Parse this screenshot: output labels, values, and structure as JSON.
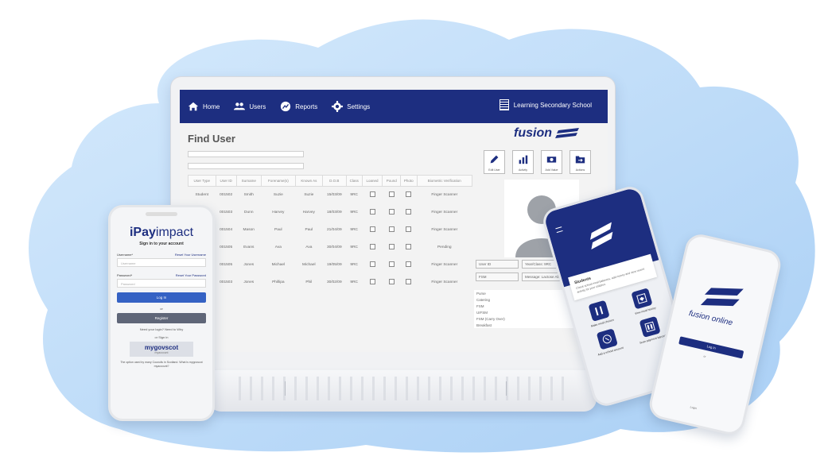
{
  "colors": {
    "brand": "#1d2e80",
    "background_blob": "#bcdcf8",
    "accent_blue": "#3562c4",
    "register_gray": "#5f6678"
  },
  "laptop": {
    "nav": {
      "home": "Home",
      "users": "Users",
      "reports": "Reports",
      "settings": "Settings",
      "school": "Learning Secondary School"
    },
    "page_title": "Find User",
    "brand_name": "fusion",
    "actions": [
      "Edit User",
      "Activity",
      "Add Value",
      "Actions"
    ],
    "table": {
      "headers": [
        "User Type",
        "User ID",
        "Surname",
        "Forename(s)",
        "Known As",
        "D.O.B",
        "Class",
        "Loaned",
        "Pound",
        "Photo",
        "Biometric Verification"
      ],
      "rows": [
        [
          "Student",
          "001502",
          "Smith",
          "Suzie",
          "Suzie",
          "15/03/09",
          "9RC",
          "Finger Scanner"
        ],
        [
          "Student",
          "001503",
          "Dunn",
          "Harvey",
          "Harvey",
          "18/03/09",
          "9RC",
          "Finger Scanner"
        ],
        [
          "Student",
          "001504",
          "Mason",
          "Paul",
          "Paul",
          "21/04/09",
          "9RC",
          "Finger Scanner"
        ],
        [
          "Student",
          "001505",
          "Evans",
          "Ava",
          "Ava",
          "30/04/09",
          "9RC",
          "Pending"
        ],
        [
          "Student",
          "001505",
          "Jones",
          "Michael",
          "Michael",
          "19/05/09",
          "9RC",
          "Finger Scanner"
        ],
        [
          "Student",
          "001503",
          "Jones",
          "Phillipa",
          "Phil",
          "30/02/09",
          "9RC",
          "Finger Scanner"
        ]
      ]
    },
    "fields": {
      "user_id": "User ID",
      "year_class": "Year/Class: 9RC",
      "dob": "D.O.B",
      "fsm": "FSM",
      "message": "Message: Lactose Allergy"
    },
    "purse": {
      "header": "Purse",
      "balance_header": "Balance",
      "rows": [
        [
          "Catering",
          "-£2.00"
        ],
        [
          "FSM",
          "+£2.40"
        ],
        [
          "UIFSM",
          "£0.00"
        ],
        [
          "FSM (Carry Over)",
          "£0.00"
        ],
        [
          "Breakfast",
          "-£1.00"
        ]
      ]
    }
  },
  "phone_login": {
    "brand_prefix": "iPay",
    "brand_suffix": "impact",
    "subtitle": "Sign in to your account",
    "username_label": "Username*",
    "username_link": "Reset Your Username",
    "username_placeholder": "Username",
    "password_label": "Password*",
    "password_link": "Reset Your Password",
    "password_placeholder": "Password",
    "login_button": "Log In",
    "or_text": "or",
    "register_button": "Register",
    "register_note": "Need your login? Need to Why",
    "signin_with": "or Sign in",
    "gov_brand": "mygovscot",
    "gov_sub": "myaccount",
    "footer": "The option used by many Councils in Scotland. What is mygovscot myaccount?"
  },
  "phone_app": {
    "card_title": "Students",
    "card_desc": "Check school meal balances, add money and view recent activity for your children.",
    "tiles": [
      "Make meal choices",
      "View meal history",
      "Add a school account",
      "Scan payment barcode"
    ]
  },
  "phone_online": {
    "brand": "fusion online",
    "button": "Log In",
    "small": "or",
    "bottom": "Login"
  }
}
